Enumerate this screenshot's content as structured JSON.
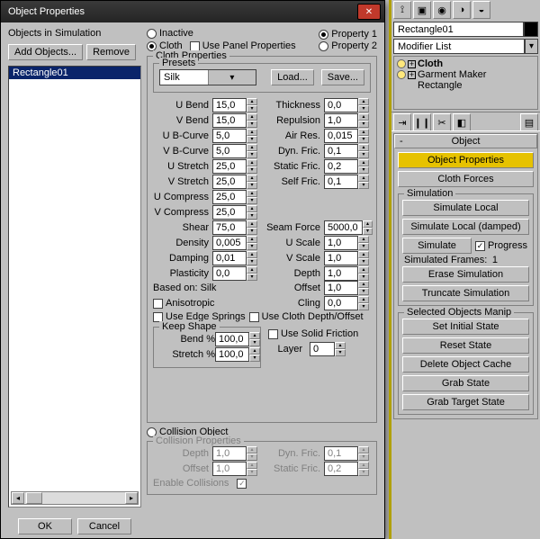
{
  "dialog": {
    "title": "Object Properties",
    "left": {
      "heading": "Objects in Simulation",
      "add_btn": "Add Objects...",
      "remove_btn": "Remove",
      "items": [
        "Rectangle01"
      ],
      "ok": "OK",
      "cancel": "Cancel"
    },
    "top": {
      "inactive": "Inactive",
      "cloth": "Cloth",
      "use_panel": "Use Panel Properties",
      "prop1": "Property 1",
      "prop2": "Property 2"
    },
    "cloth_fs": "Cloth Properties",
    "presets_fs": "Presets",
    "preset_value": "Silk",
    "load_btn": "Load...",
    "save_btn": "Save...",
    "params_left_labels": [
      "U Bend",
      "V Bend",
      "U B-Curve",
      "V B-Curve",
      "U Stretch",
      "V Stretch",
      "U Compress",
      "V Compress",
      "Shear",
      "Density",
      "Damping",
      "Plasticity"
    ],
    "params_left_values": [
      "15,0",
      "15,0",
      "5,0",
      "5,0",
      "25,0",
      "25,0",
      "25,0",
      "25,0",
      "75,0",
      "0,005",
      "0,01",
      "0,0"
    ],
    "params_right_labels": [
      "Thickness",
      "Repulsion",
      "Air Res.",
      "Dyn. Fric.",
      "Static Fric.",
      "Self Fric."
    ],
    "params_right_values": [
      "0,0",
      "1,0",
      "0,015",
      "0,1",
      "0,2",
      "0,1"
    ],
    "seam_labels": [
      "Seam Force",
      "U Scale",
      "V Scale",
      "Depth",
      "Offset",
      "Cling"
    ],
    "seam_values": [
      "5000,0",
      "1,0",
      "1,0",
      "1,0",
      "1,0",
      "0,0"
    ],
    "based_on": "Based on: Silk",
    "anisotropic": "Anisotropic",
    "edge_springs": "Use Edge Springs",
    "cloth_depth": "Use Cloth Depth/Offset",
    "keep_shape_fs": "Keep Shape",
    "bend_pct_label": "Bend %",
    "bend_pct": "100,0",
    "stretch_pct_label": "Stretch %",
    "stretch_pct": "100,0",
    "solid_fric": "Use Solid Friction",
    "layer_label": "Layer",
    "layer": "0",
    "collision_obj": "Collision Object",
    "collision_fs": "Collision Properties",
    "coll_depth_label": "Depth",
    "coll_depth": "1,0",
    "coll_offset_label": "Offset",
    "coll_offset": "1,0",
    "coll_dyn_label": "Dyn. Fric.",
    "coll_dyn": "0,1",
    "coll_static_label": "Static Fric.",
    "coll_static": "0,2",
    "enable_coll": "Enable Collisions"
  },
  "panel": {
    "obj_name": "Rectangle01",
    "mod_list_label": "Modifier List",
    "tree": [
      "Cloth",
      "Garment Maker",
      "Rectangle"
    ],
    "rollout_object": "Object",
    "btn_obj_props": "Object Properties",
    "btn_cloth_forces": "Cloth Forces",
    "fs_sim": "Simulation",
    "btn_sim_local": "Simulate Local",
    "btn_sim_local_d": "Simulate Local (damped)",
    "btn_sim": "Simulate",
    "chk_progress": "Progress",
    "frames_label": "Simulated Frames:",
    "frames_val": "1",
    "btn_erase": "Erase Simulation",
    "btn_trunc": "Truncate Simulation",
    "fs_sel": "Selected Objects Manip",
    "btn_set_init": "Set Initial State",
    "btn_reset": "Reset State",
    "btn_del_cache": "Delete Object Cache",
    "btn_grab": "Grab State",
    "btn_grab_target": "Grab Target State"
  }
}
